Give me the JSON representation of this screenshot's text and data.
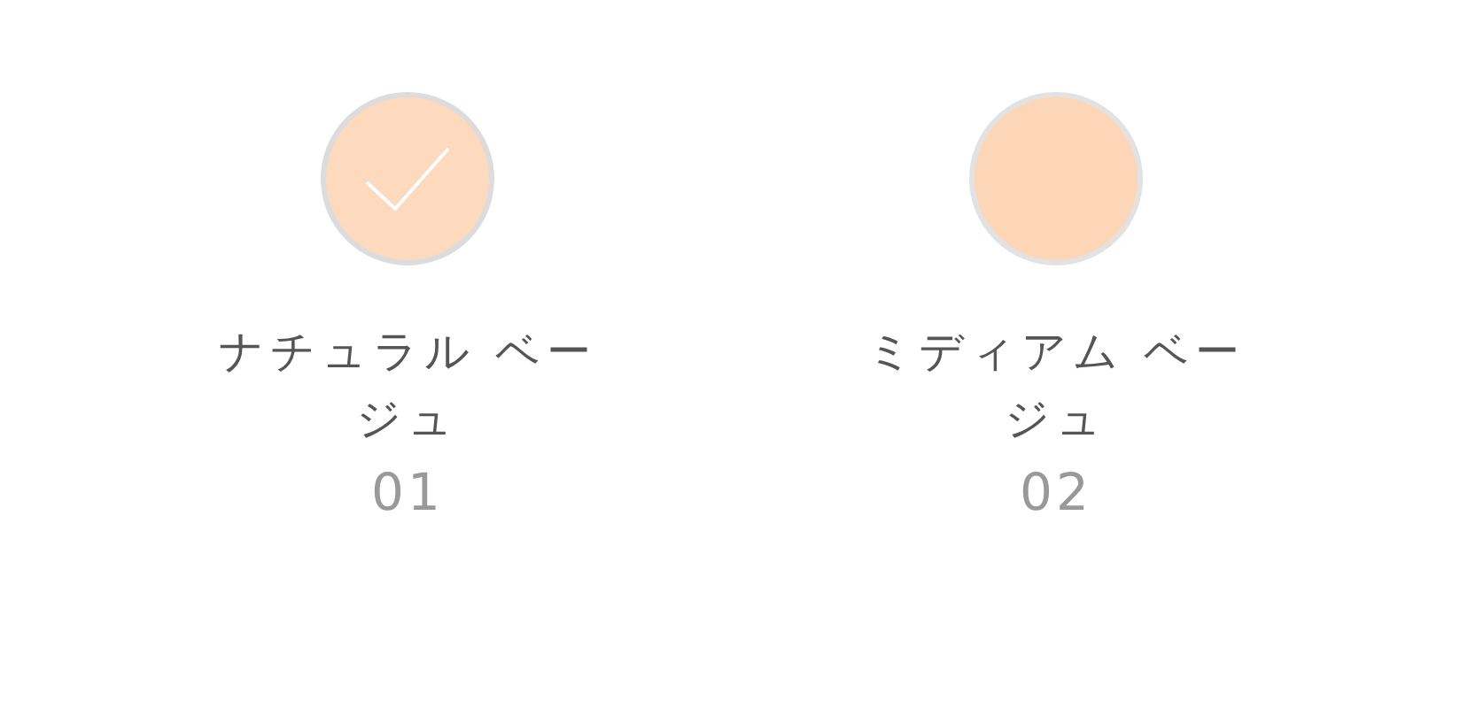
{
  "swatches": [
    {
      "name": "ナチュラル ベージュ",
      "number": "01",
      "color": "#fddabd",
      "selected": true
    },
    {
      "name": "ミディアム ベージュ",
      "number": "02",
      "color": "#fdd6b7",
      "selected": false
    }
  ]
}
